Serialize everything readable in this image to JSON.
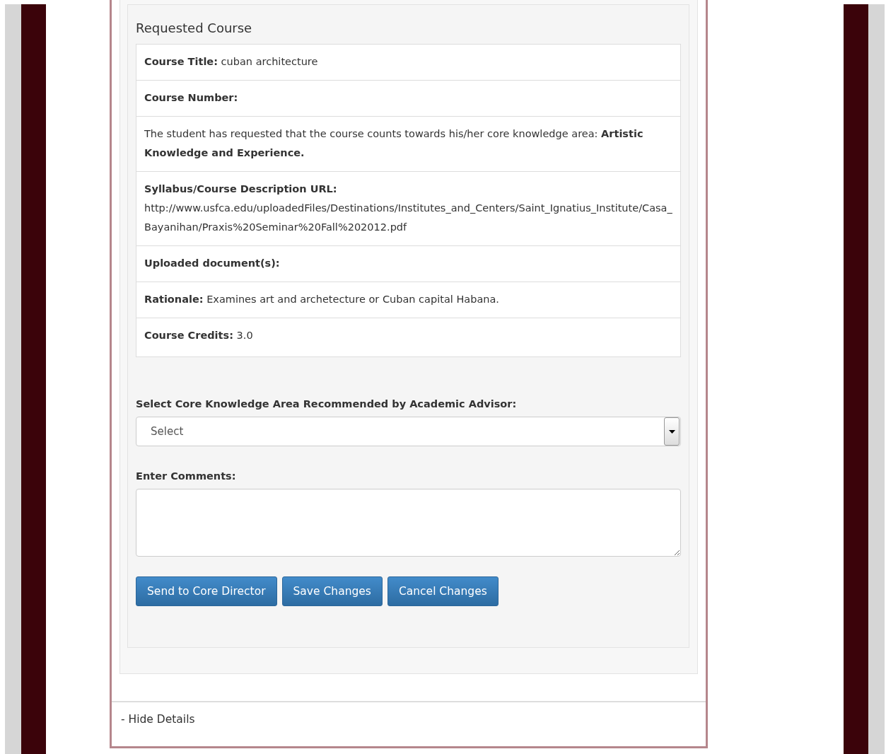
{
  "section_title": "Requested Course",
  "details": [
    {
      "kind": "field",
      "label": "Course Title:",
      "value": "cuban architecture"
    },
    {
      "kind": "field",
      "label": "Course Number:"
    },
    {
      "kind": "text",
      "text": "The student has requested that the course counts towards his/her core knowledge area: **Artistic Knowledge and Experience.**"
    },
    {
      "kind": "url",
      "label": "Syllabus/Course Description URL:",
      "value": "http://www.usfca.edu/uploadedFiles/Destinations/Institutes_and_Centers/Saint_Ignatius_Institute/Casa_Bayanihan/Praxis%20Seminar%20Fall%202012.pdf"
    },
    {
      "kind": "field",
      "label": "Uploaded document(s):"
    },
    {
      "kind": "field",
      "label": "Rationale:",
      "value": "Examines art and archetecture or Cuban capital Habana."
    },
    {
      "kind": "field",
      "label": "Course Credits:",
      "value": "3.0"
    }
  ],
  "select": {
    "label": "Select Core Knowledge Area Recommended by Academic Advisor:",
    "value": "Select"
  },
  "comments": {
    "label": "Enter Comments:"
  },
  "buttons": [
    "Send to Core Director",
    "Save Changes",
    "Cancel Changes"
  ],
  "toggle": "- Hide Details"
}
